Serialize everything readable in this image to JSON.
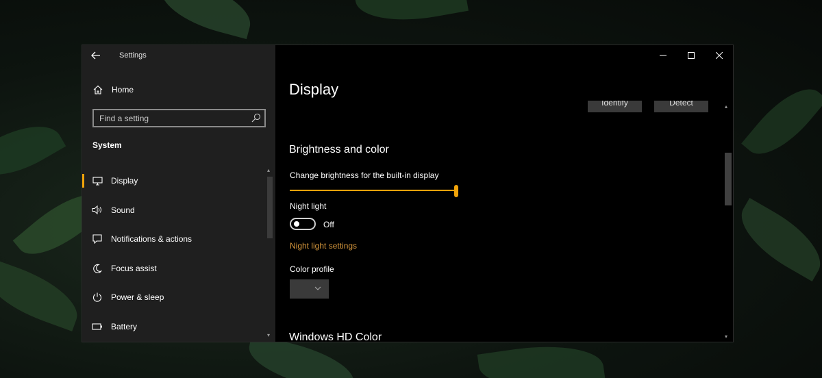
{
  "window": {
    "title": "Settings",
    "caption_buttons": {
      "minimize": "minimize",
      "maximize": "maximize",
      "close": "close"
    }
  },
  "sidebar": {
    "home_label": "Home",
    "search_placeholder": "Find a setting",
    "section_label": "System",
    "items": [
      {
        "label": "Display",
        "icon": "monitor-icon",
        "active": true
      },
      {
        "label": "Sound",
        "icon": "speaker-icon",
        "active": false
      },
      {
        "label": "Notifications & actions",
        "icon": "notification-icon",
        "active": false
      },
      {
        "label": "Focus assist",
        "icon": "moon-icon",
        "active": false
      },
      {
        "label": "Power & sleep",
        "icon": "power-icon",
        "active": false
      },
      {
        "label": "Battery",
        "icon": "battery-icon",
        "active": false
      }
    ]
  },
  "main": {
    "page_title": "Display",
    "top_buttons": {
      "identify": "Identify",
      "detect": "Detect"
    },
    "brightness_section": {
      "heading": "Brightness and color",
      "slider_label": "Change brightness for the built-in display",
      "brightness_value": 1.0
    },
    "night_light": {
      "label": "Night light",
      "toggle_state": "Off",
      "settings_link": "Night light settings"
    },
    "color_profile": {
      "label": "Color profile",
      "selected_value": ""
    },
    "hd_color_heading": "Windows HD Color"
  },
  "colors": {
    "accent": "#f0a30a",
    "link": "#d4963c",
    "sidebar_bg": "#1f1f1f",
    "main_bg": "#000000"
  }
}
